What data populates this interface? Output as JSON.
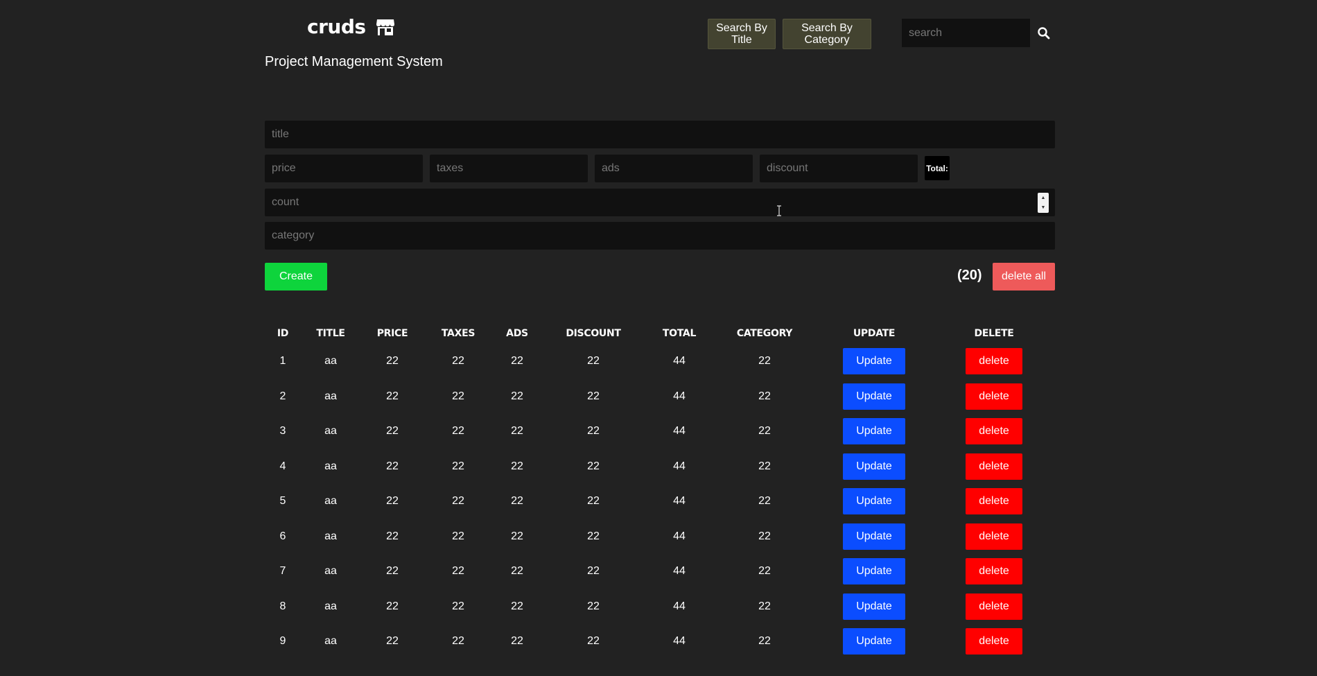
{
  "header": {
    "brand": "cruds",
    "subtitle": "Project Management System",
    "search_by_title": "Search By Title",
    "search_by_category": "Search By Category",
    "search_placeholder": "search"
  },
  "form": {
    "title_placeholder": "title",
    "price_placeholder": "price",
    "taxes_placeholder": "taxes",
    "ads_placeholder": "ads",
    "discount_placeholder": "discount",
    "total_label": "Total:",
    "count_placeholder": "count",
    "category_placeholder": "category",
    "create_label": "Create",
    "count_display": "(20)",
    "delete_all_label": "delete all"
  },
  "table": {
    "columns": [
      "ID",
      "TITLE",
      "PRICE",
      "TAXES",
      "ADS",
      "DISCOUNT",
      "TOTAL",
      "CATEGORY",
      "UPDATE",
      "DELETE"
    ],
    "update_label": "Update",
    "delete_label": "delete",
    "rows": [
      [
        "1",
        "aa",
        "22",
        "22",
        "22",
        "22",
        "44",
        "22"
      ],
      [
        "2",
        "aa",
        "22",
        "22",
        "22",
        "22",
        "44",
        "22"
      ],
      [
        "3",
        "aa",
        "22",
        "22",
        "22",
        "22",
        "44",
        "22"
      ],
      [
        "4",
        "aa",
        "22",
        "22",
        "22",
        "22",
        "44",
        "22"
      ],
      [
        "5",
        "aa",
        "22",
        "22",
        "22",
        "22",
        "44",
        "22"
      ],
      [
        "6",
        "aa",
        "22",
        "22",
        "22",
        "22",
        "44",
        "22"
      ],
      [
        "7",
        "aa",
        "22",
        "22",
        "22",
        "22",
        "44",
        "22"
      ],
      [
        "8",
        "aa",
        "22",
        "22",
        "22",
        "22",
        "44",
        "22"
      ],
      [
        "9",
        "aa",
        "22",
        "22",
        "22",
        "22",
        "44",
        "22"
      ]
    ]
  },
  "colors": {
    "background": "#222222",
    "create": "#0ed43c",
    "delete_all": "#ee5a5a",
    "update": "#0b4dff",
    "delete": "#ff0000",
    "search_button": "#434330"
  }
}
